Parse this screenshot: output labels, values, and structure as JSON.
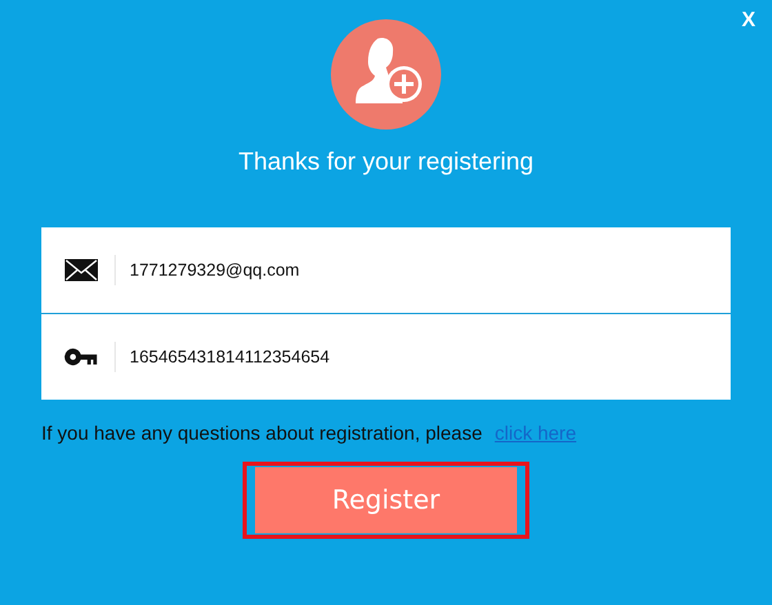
{
  "close_label": "X",
  "title": "Thanks for your registering",
  "fields": [
    {
      "kind": "email",
      "value": "1771279329@qq.com"
    },
    {
      "kind": "key",
      "value": "165465431814112354654"
    }
  ],
  "help": {
    "text": "If you have any questions about registration, please",
    "link": "click here"
  },
  "register_button": {
    "label": "Register",
    "focused": true
  }
}
